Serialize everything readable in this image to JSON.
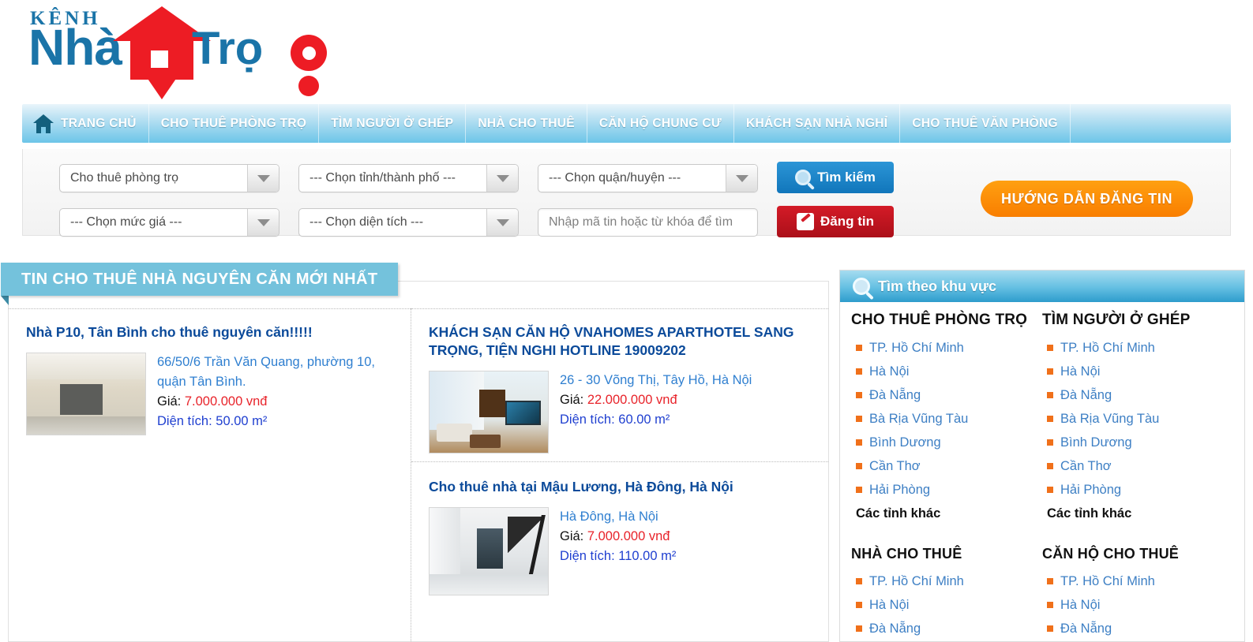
{
  "site": {
    "logo_top": "KÊNH",
    "logo_main": "Nhà",
    "logo_sub": "Trọ"
  },
  "nav": {
    "home_label": "TRANG CHỦ",
    "items": [
      {
        "label": "CHO THUÊ PHÒNG TRỌ"
      },
      {
        "label": "TÌM NGƯỜI Ở GHÉP"
      },
      {
        "label": "NHÀ CHO THUÊ"
      },
      {
        "label": "CĂN HỘ CHUNG CƯ"
      },
      {
        "label": "KHÁCH SẠN NHÀ NGHỈ"
      },
      {
        "label": "CHO THUÊ VĂN PHÒNG"
      }
    ]
  },
  "search": {
    "type_value": "Cho thuê phòng trọ",
    "province_value": "--- Chọn tỉnh/thành phố ---",
    "district_value": "--- Chọn quận/huyện ---",
    "price_value": "--- Chọn mức giá ---",
    "area_value": "--- Chọn diện tích ---",
    "keyword_placeholder": "Nhập mã tin hoặc từ khóa để tìm",
    "keyword_value": "",
    "search_label": "Tìm kiếm",
    "post_label": "Đăng tin",
    "guide_label": "HƯỚNG DẪN ĐĂNG TIN"
  },
  "content": {
    "section_title": "TIN CHO THUÊ NHÀ NGUYÊN CĂN MỚI NHẤT",
    "price_label": "Giá:",
    "area_label": "Diện tích:",
    "listings": [
      {
        "title": "Nhà P10, Tân Bình cho thuê nguyên căn!!!!!",
        "address_line1": "66/50/6 Trần Văn Quang, phường 10,",
        "address_line2": "quận Tân Bình.",
        "price": "7.000.000 vnđ",
        "area": "50.00 m²"
      },
      {
        "title": "KHÁCH SẠN CĂN HỘ VNAHOMES APARTHOTEL SANG TRỌNG, TIỆN NGHI HOTLINE 19009202",
        "address_line1": "26 - 30 Võng Thị, Tây Hồ, Hà Nội",
        "address_line2": "",
        "price": "22.000.000 vnđ",
        "area": "60.00 m²"
      },
      {
        "title": "Cho thuê nhà tại Mậu Lương, Hà Đông, Hà Nội",
        "address_line1": "Hà Đông, Hà Nội",
        "address_line2": "",
        "price": "7.000.000 vnđ",
        "area": "110.00 m²"
      }
    ]
  },
  "sidebar": {
    "header": "Tìm theo khu vực",
    "more_label": "Các tỉnh khác",
    "groups": [
      {
        "title": "CHO THUÊ PHÒNG TRỌ",
        "regions": [
          "TP. Hồ Chí Minh",
          "Hà Nội",
          "Đà Nẵng",
          "Bà Rịa Vũng Tàu",
          "Bình Dương",
          "Cần Thơ",
          "Hải Phòng"
        ]
      },
      {
        "title": "TÌM NGƯỜI Ở GHÉP",
        "regions": [
          "TP. Hồ Chí Minh",
          "Hà Nội",
          "Đà Nẵng",
          "Bà Rịa Vũng Tàu",
          "Bình Dương",
          "Cần Thơ",
          "Hải Phòng"
        ]
      },
      {
        "title": "NHÀ CHO THUÊ",
        "regions": [
          "TP. Hồ Chí Minh",
          "Hà Nội",
          "Đà Nẵng"
        ]
      },
      {
        "title": "CĂN HỘ CHO THUÊ",
        "regions": [
          "TP. Hồ Chí Minh",
          "Hà Nội",
          "Đà Nẵng"
        ]
      }
    ]
  },
  "colors": {
    "brand_blue": "#1a74a8",
    "brand_red": "#ed1c24",
    "nav_blue": "#6cc5e8",
    "accent_orange": "#f97e00",
    "bullet_orange": "#f0701a",
    "price_red": "#e8232a",
    "area_blue": "#1f3fd0",
    "link_blue": "#3d7fc4"
  }
}
